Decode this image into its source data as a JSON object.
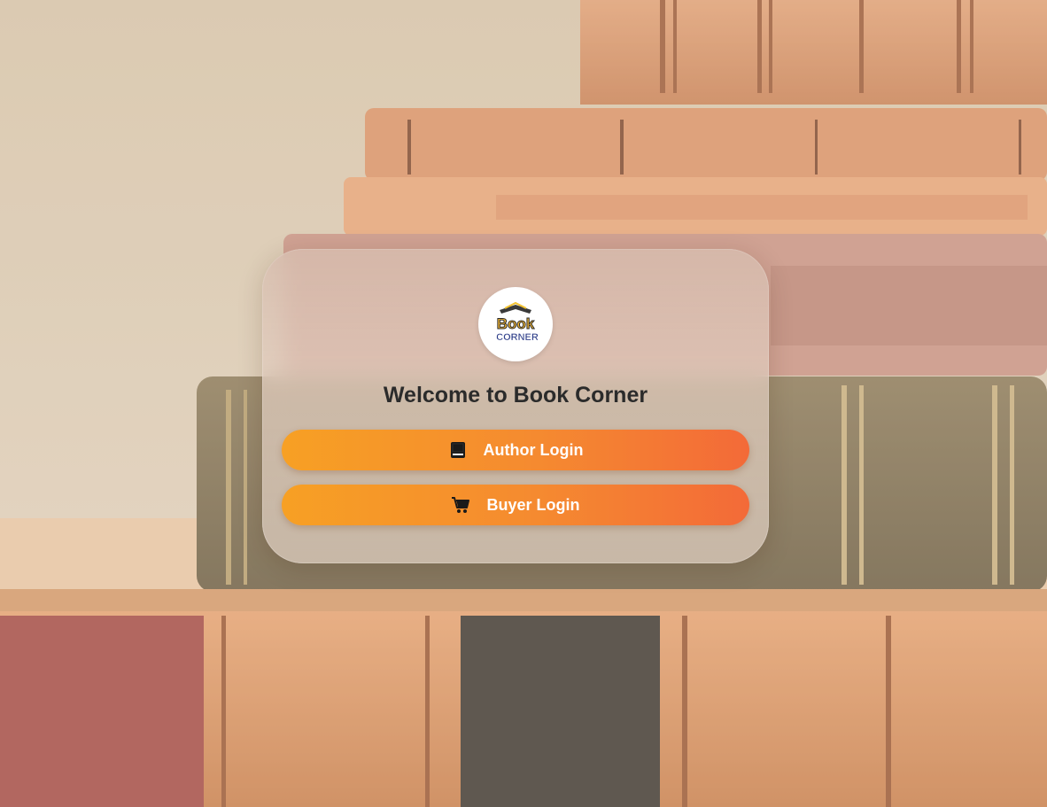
{
  "page": {
    "title": "Welcome to Book Corner"
  },
  "logo": {
    "line1": "Book",
    "line2": "CORNER"
  },
  "buttons": {
    "author_login": {
      "label": "Author Login",
      "icon": "book-icon"
    },
    "buyer_login": {
      "label": "Buyer Login",
      "icon": "cart-icon"
    }
  },
  "colors": {
    "button_gradient_start": "#f7a024",
    "button_gradient_end": "#f36a38",
    "title_text": "#2b2b2b",
    "background": "#d8c7ae"
  }
}
